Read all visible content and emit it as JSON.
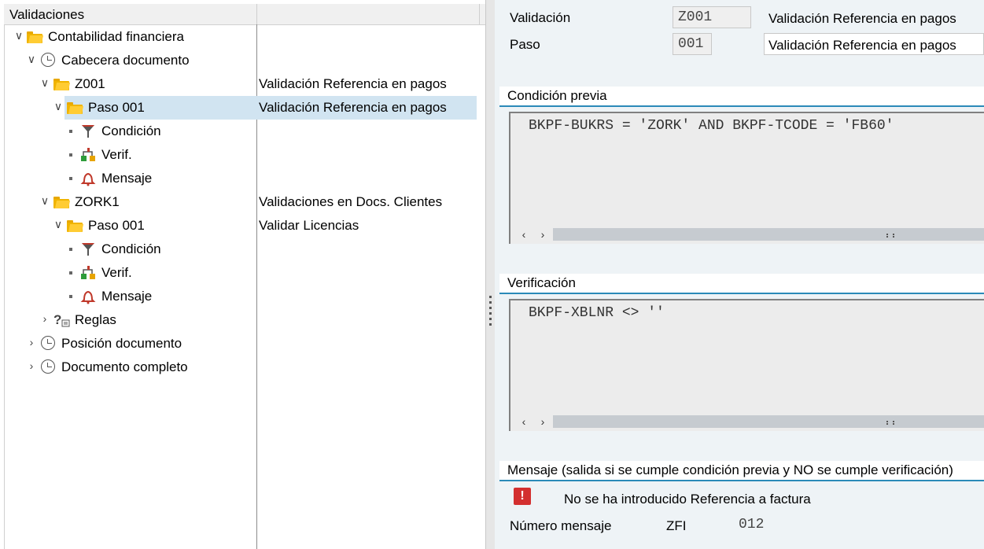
{
  "tree": {
    "header": "Validaciones",
    "rows": [
      {
        "label": "Contabilidad financiera",
        "desc": ""
      },
      {
        "label": "Cabecera documento",
        "desc": ""
      },
      {
        "label": "Z001",
        "desc": "Validación Referencia en pagos"
      },
      {
        "label": "Paso 001",
        "desc": "Validación Referencia en pagos"
      },
      {
        "label": "Condición",
        "desc": ""
      },
      {
        "label": "Verif.",
        "desc": ""
      },
      {
        "label": "Mensaje",
        "desc": ""
      },
      {
        "label": "ZORK1",
        "desc": "Validaciones en Docs. Clientes"
      },
      {
        "label": "Paso 001",
        "desc": "Validar Licencias"
      },
      {
        "label": "Condición",
        "desc": ""
      },
      {
        "label": "Verif.",
        "desc": ""
      },
      {
        "label": "Mensaje",
        "desc": ""
      },
      {
        "label": "Reglas",
        "desc": ""
      },
      {
        "label": "Posición documento",
        "desc": ""
      },
      {
        "label": "Documento completo",
        "desc": ""
      }
    ]
  },
  "detail": {
    "validacion_label": "Validación",
    "validacion_value": "Z001",
    "validacion_desc": "Validación Referencia en pagos",
    "paso_label": "Paso",
    "paso_value": "001",
    "paso_desc": "Validación Referencia en pagos"
  },
  "condicion": {
    "title": "Condición previa",
    "code": "BKPF-BUKRS = 'ZORK' AND BKPF-TCODE = 'FB60'"
  },
  "verificacion": {
    "title": "Verificación",
    "code": "BKPF-XBLNR <> ''"
  },
  "mensaje": {
    "title": "Mensaje (salida si se cumple condición previa y NO se cumple verificación)",
    "icon": "!",
    "text": "No se ha introducido Referencia a factura",
    "numero_label": "Número mensaje",
    "clase": "ZFI",
    "numero": "012"
  },
  "colors": {
    "selection": "#d1e4f1",
    "accent_line": "#2b8ab8",
    "error_icon": "#d32f2f",
    "folder": "#f0b400"
  }
}
